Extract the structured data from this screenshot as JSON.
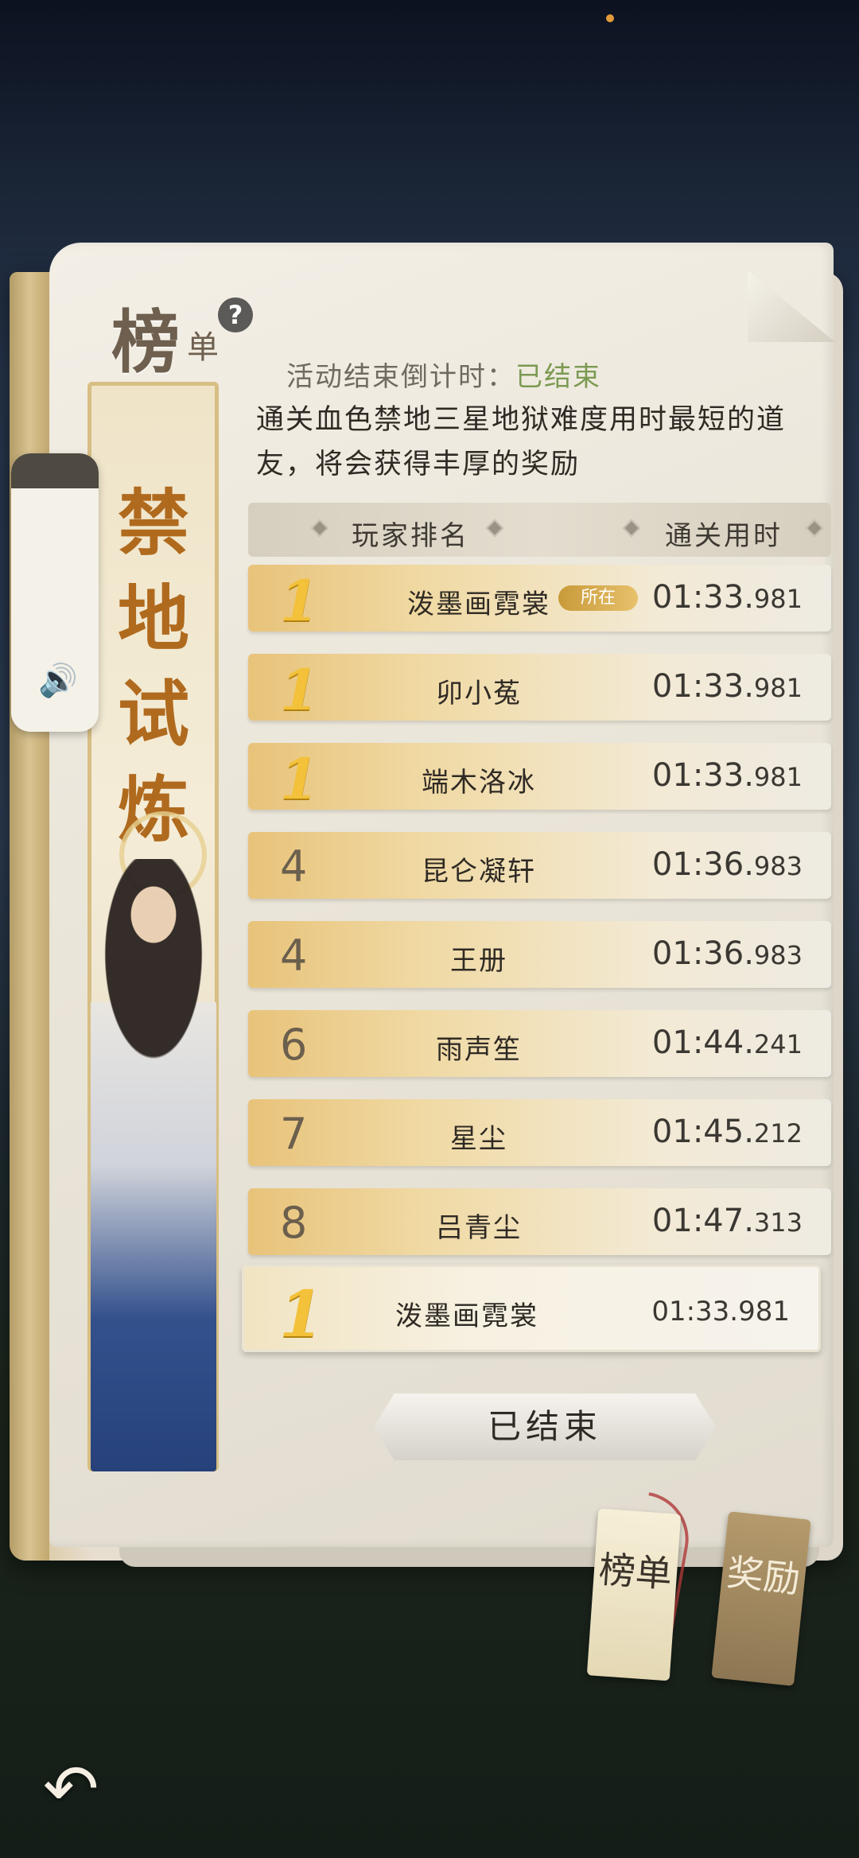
{
  "title": {
    "main": "榜",
    "sub": "单",
    "help": "?"
  },
  "banner": {
    "chars": [
      "禁",
      "地",
      "试",
      "炼"
    ]
  },
  "countdown": {
    "label": "活动结束倒计时：",
    "value": "已结束"
  },
  "description": "通关血色禁地三星地狱难度用时最短的道友，将会获得丰厚的奖励",
  "table": {
    "col_rank": "玩家排名",
    "col_time": "通关用时",
    "rows": [
      {
        "rank": "1",
        "name": "泼墨画霓裳",
        "time": "01:33.",
        "ms": "981",
        "badge": "所在"
      },
      {
        "rank": "1",
        "name": "卯小菟",
        "time": "01:33.",
        "ms": "981"
      },
      {
        "rank": "1",
        "name": "端木洛冰",
        "time": "01:33.",
        "ms": "981"
      },
      {
        "rank": "4",
        "name": "昆仑凝轩",
        "time": "01:36.",
        "ms": "983"
      },
      {
        "rank": "4",
        "name": "王册",
        "time": "01:36.",
        "ms": "983"
      },
      {
        "rank": "6",
        "name": "雨声笙",
        "time": "01:44.",
        "ms": "241"
      },
      {
        "rank": "7",
        "name": "星尘",
        "time": "01:45.",
        "ms": "212"
      },
      {
        "rank": "8",
        "name": "吕青尘",
        "time": "01:47.",
        "ms": "313"
      }
    ]
  },
  "my_record": {
    "rank": "1",
    "name": "泼墨画霓裳",
    "time": "01:33.981"
  },
  "ended_button": "已结束",
  "tabs": {
    "rank": "榜单",
    "reward": "奖励"
  },
  "volume_icon": "🔊",
  "back_icon": "↶"
}
